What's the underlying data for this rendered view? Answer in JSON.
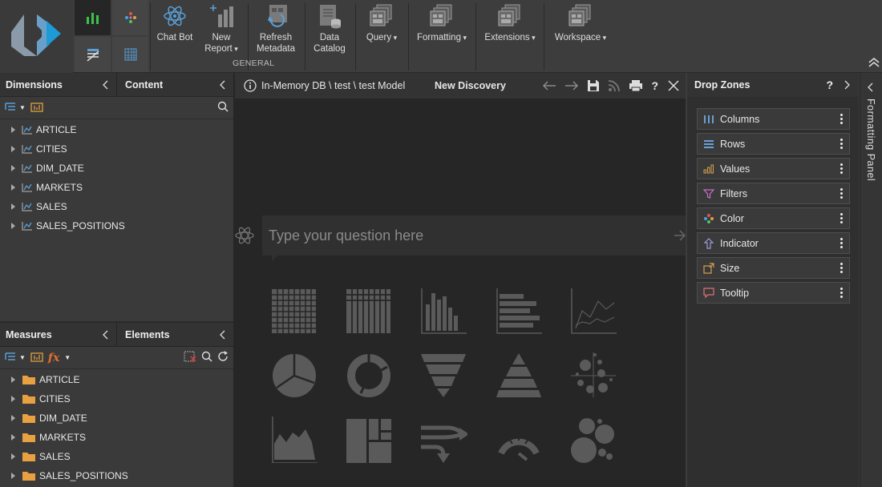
{
  "toolbar": {
    "chatbot": {
      "label": "Chat Bot"
    },
    "new_report": {
      "label1": "New",
      "label2": "Report"
    },
    "refresh_metadata": {
      "label1": "Refresh",
      "label2": "Metadata"
    },
    "data_catalog": {
      "label1": "Data",
      "label2": "Catalog"
    },
    "group_label": "GENERAL",
    "query": {
      "label": "Query"
    },
    "formatting": {
      "label": "Formatting"
    },
    "extensions": {
      "label": "Extensions"
    },
    "workspace": {
      "label": "Workspace"
    }
  },
  "dimensions_panel": {
    "title": "Dimensions",
    "items": [
      "ARTICLE",
      "CITIES",
      "DIM_DATE",
      "MARKETS",
      "SALES",
      "SALES_POSITIONS"
    ]
  },
  "content_panel": {
    "title": "Content"
  },
  "measures_panel": {
    "title": "Measures",
    "items": [
      "ARTICLE",
      "CITIES",
      "DIM_DATE",
      "MARKETS",
      "SALES",
      "SALES_POSITIONS"
    ]
  },
  "elements_panel": {
    "title": "Elements"
  },
  "center": {
    "breadcrumb": "In-Memory DB \\ test \\ test Model",
    "title": "New Discovery",
    "question_placeholder": "Type your question here"
  },
  "drop_zones": {
    "title": "Drop Zones",
    "help": "?",
    "zones": [
      {
        "label": "Columns",
        "icon": "columns-icon",
        "color": "#6a9fd4"
      },
      {
        "label": "Rows",
        "icon": "rows-icon",
        "color": "#6a9fd4"
      },
      {
        "label": "Values",
        "icon": "values-icon",
        "color": "#d4a050"
      },
      {
        "label": "Filters",
        "icon": "filter-icon",
        "color": "#c76fc7"
      },
      {
        "label": "Color",
        "icon": "color-icon",
        "color": "#e07050"
      },
      {
        "label": "Indicator",
        "icon": "indicator-icon",
        "color": "#9a9ad8"
      },
      {
        "label": "Size",
        "icon": "size-icon",
        "color": "#d4a050"
      },
      {
        "label": "Tooltip",
        "icon": "tooltip-icon",
        "color": "#e07070"
      }
    ]
  },
  "formatting_panel": {
    "label": "Formatting Panel"
  },
  "chart_types": [
    "table",
    "crosstab",
    "column-chart",
    "bar-chart",
    "line-chart",
    "pie-chart",
    "donut-chart",
    "funnel-chart",
    "pyramid-chart",
    "scatter-chart",
    "area-chart",
    "treemap-chart",
    "sankey-chart",
    "gauge-chart",
    "bubble-chart"
  ]
}
